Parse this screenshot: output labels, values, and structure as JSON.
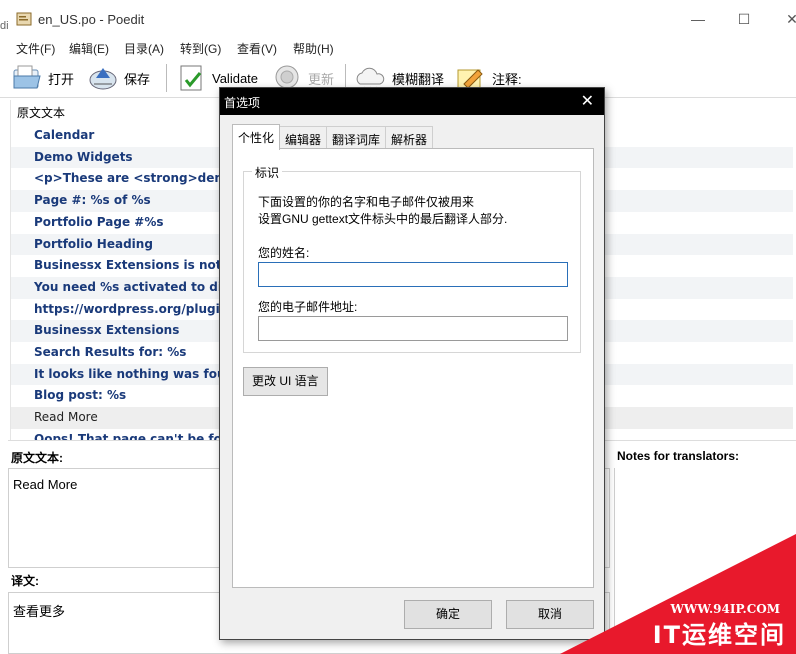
{
  "window": {
    "title": "en_US.po - Poedit",
    "left_sliver": "di"
  },
  "menu": [
    "文件(F)",
    "编辑(E)",
    "目录(A)",
    "转到(G)",
    "查看(V)",
    "帮助(H)"
  ],
  "toolbar": {
    "open": "打开",
    "save": "保存",
    "validate": "Validate",
    "update": "更新",
    "fuzzy": "模糊翻译",
    "comment": "注释:"
  },
  "list": {
    "header": "原文文本",
    "rows": [
      "Calendar",
      "Demo Widgets",
      "<p>These are <strong>demo",
      "Page #: %s of %s",
      "Portfolio Page #%s",
      "Portfolio Heading",
      "Businessx Extensions is not a",
      "You need %s activated to dis",
      "https://wordpress.org/plugin",
      "Businessx Extensions",
      "Search Results for: %s",
      "It looks like nothing was fou",
      "Blog post: %s",
      "Read More",
      "Oops! That page can't be fou"
    ]
  },
  "editor": {
    "source_label": "原文文本:",
    "source_text": "Read More",
    "translation_label": "译文:",
    "translation_text": "查看更多",
    "notes_label": "Notes for translators:"
  },
  "dialog": {
    "title": "首选项",
    "tabs": [
      "个性化",
      "编辑器",
      "翻译词库",
      "解析器"
    ],
    "group_title": "标识",
    "description_line1": "下面设置的你的名字和电子邮件仅被用来",
    "description_line2": "设置GNU gettext文件标头中的最后翻译人部分.",
    "name_label": "您的姓名:",
    "name_value": "",
    "email_label": "您的电子邮件地址:",
    "email_value": "",
    "change_ui_language": "更改 UI 语言",
    "ok": "确定",
    "cancel": "取消"
  },
  "watermark": {
    "url": "WWW.94IP.COM",
    "brand": "IT运维空间"
  }
}
